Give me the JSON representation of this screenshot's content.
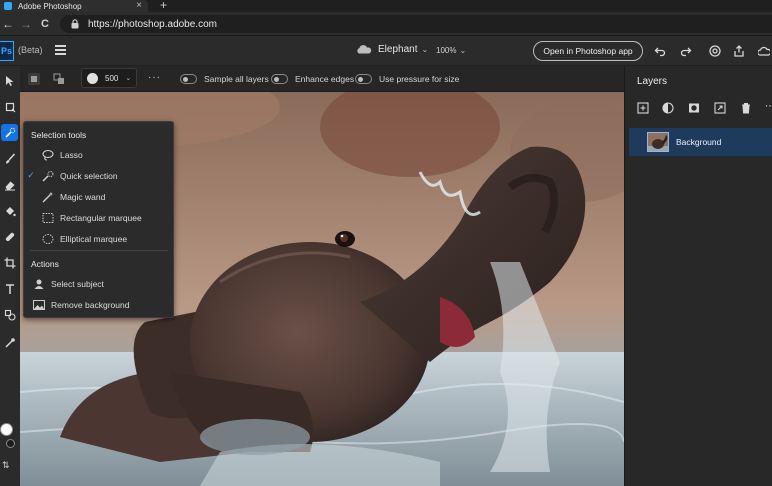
{
  "browser": {
    "tab_title": "Adobe Photoshop",
    "tab_close": "×",
    "new_tab": "+",
    "back": "←",
    "forward": "→",
    "reload": "C",
    "url": "https://photoshop.adobe.com"
  },
  "header": {
    "logo": "Ps",
    "beta": "(Beta)",
    "doc_name": "Elephant",
    "zoom": "100%",
    "open_button": "Open in Photoshop app"
  },
  "options": {
    "brush_size": "500",
    "more": "···",
    "sample_all_layers": "Sample all layers",
    "enhance_edges": "Enhance edges",
    "use_pressure": "Use pressure for size"
  },
  "flyout": {
    "section1": "Selection tools",
    "items": [
      {
        "label": "Lasso",
        "checked": false,
        "icon": "lasso-icon"
      },
      {
        "label": "Quick selection",
        "checked": true,
        "icon": "quick-selection-icon"
      },
      {
        "label": "Magic wand",
        "checked": false,
        "icon": "magic-wand-icon"
      },
      {
        "label": "Rectangular marquee",
        "checked": false,
        "icon": "rect-marquee-icon"
      },
      {
        "label": "Elliptical marquee",
        "checked": false,
        "icon": "ellipse-marquee-icon"
      }
    ],
    "section2": "Actions",
    "actions": [
      {
        "label": "Select subject",
        "icon": "select-subject-icon"
      },
      {
        "label": "Remove background",
        "icon": "remove-background-icon"
      }
    ],
    "check_glyph": "✓"
  },
  "layers": {
    "title": "Layers",
    "items": [
      {
        "name": "Background",
        "selected": true
      }
    ]
  },
  "colors": {
    "accent": "#1473e6",
    "foreground": "#ffffff",
    "background_swatch": "#1d1d1d",
    "ps_blue": "#31a8ff"
  }
}
